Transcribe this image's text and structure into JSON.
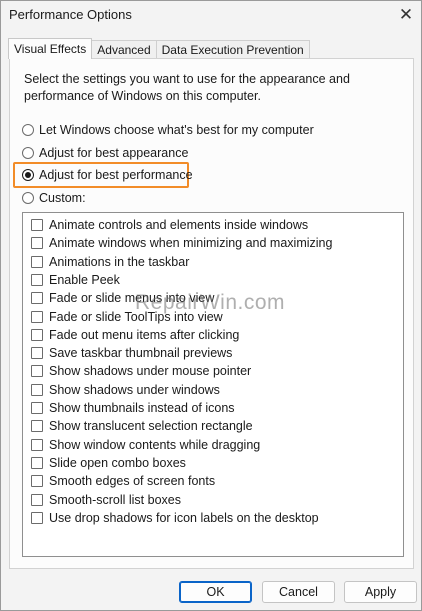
{
  "window": {
    "title": "Performance Options"
  },
  "tabs": [
    {
      "label": "Visual Effects",
      "active": true
    },
    {
      "label": "Advanced",
      "active": false
    },
    {
      "label": "Data Execution Prevention",
      "active": false
    }
  ],
  "description": "Select the settings you want to use for the appearance and performance of Windows on this computer.",
  "radio_options": [
    {
      "label": "Let Windows choose what's best for my computer",
      "checked": false
    },
    {
      "label": "Adjust for best appearance",
      "checked": false
    },
    {
      "label": "Adjust for best performance",
      "checked": true
    },
    {
      "label": "Custom:",
      "checked": false
    }
  ],
  "effects": [
    {
      "label": "Animate controls and elements inside windows",
      "checked": false
    },
    {
      "label": "Animate windows when minimizing and maximizing",
      "checked": false
    },
    {
      "label": "Animations in the taskbar",
      "checked": false
    },
    {
      "label": "Enable Peek",
      "checked": false
    },
    {
      "label": "Fade or slide menus into view",
      "checked": false
    },
    {
      "label": "Fade or slide ToolTips into view",
      "checked": false
    },
    {
      "label": "Fade out menu items after clicking",
      "checked": false
    },
    {
      "label": "Save taskbar thumbnail previews",
      "checked": false
    },
    {
      "label": "Show shadows under mouse pointer",
      "checked": false
    },
    {
      "label": "Show shadows under windows",
      "checked": false
    },
    {
      "label": "Show thumbnails instead of icons",
      "checked": false
    },
    {
      "label": "Show translucent selection rectangle",
      "checked": false
    },
    {
      "label": "Show window contents while dragging",
      "checked": false
    },
    {
      "label": "Slide open combo boxes",
      "checked": false
    },
    {
      "label": "Smooth edges of screen fonts",
      "checked": false
    },
    {
      "label": "Smooth-scroll list boxes",
      "checked": false
    },
    {
      "label": "Use drop shadows for icon labels on the desktop",
      "checked": false
    }
  ],
  "watermark": "RepairWin.com",
  "buttons": {
    "ok": "OK",
    "cancel": "Cancel",
    "apply": "Apply"
  },
  "colors": {
    "highlight": "#f28c28",
    "default_button_border": "#0a64c8"
  },
  "icons": {
    "close": "close-icon"
  }
}
